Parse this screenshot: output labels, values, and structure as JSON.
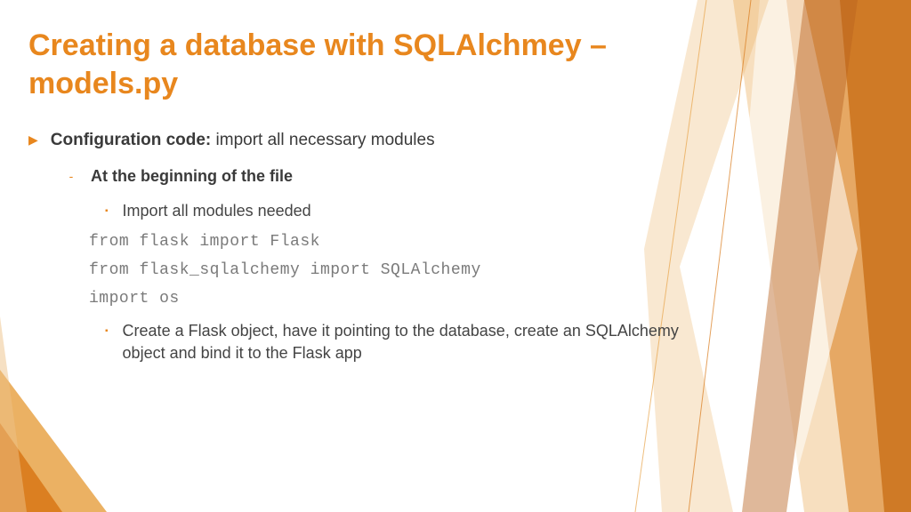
{
  "title": "Creating a database with SQLAlchmey – models.py",
  "bullet1": {
    "bold": "Configuration code:",
    "rest": " import all necessary modules"
  },
  "bullet2": "At the beginning of the file",
  "bullet3a": "Import all modules needed",
  "code": {
    "l1": "from flask import Flask",
    "l2": "from flask_sqlalchemy import SQLAlchemy",
    "l3": "import os"
  },
  "bullet3b": "Create a Flask object, have it pointing to the database, create an SQLAlchemy object and bind it to the Flask app"
}
